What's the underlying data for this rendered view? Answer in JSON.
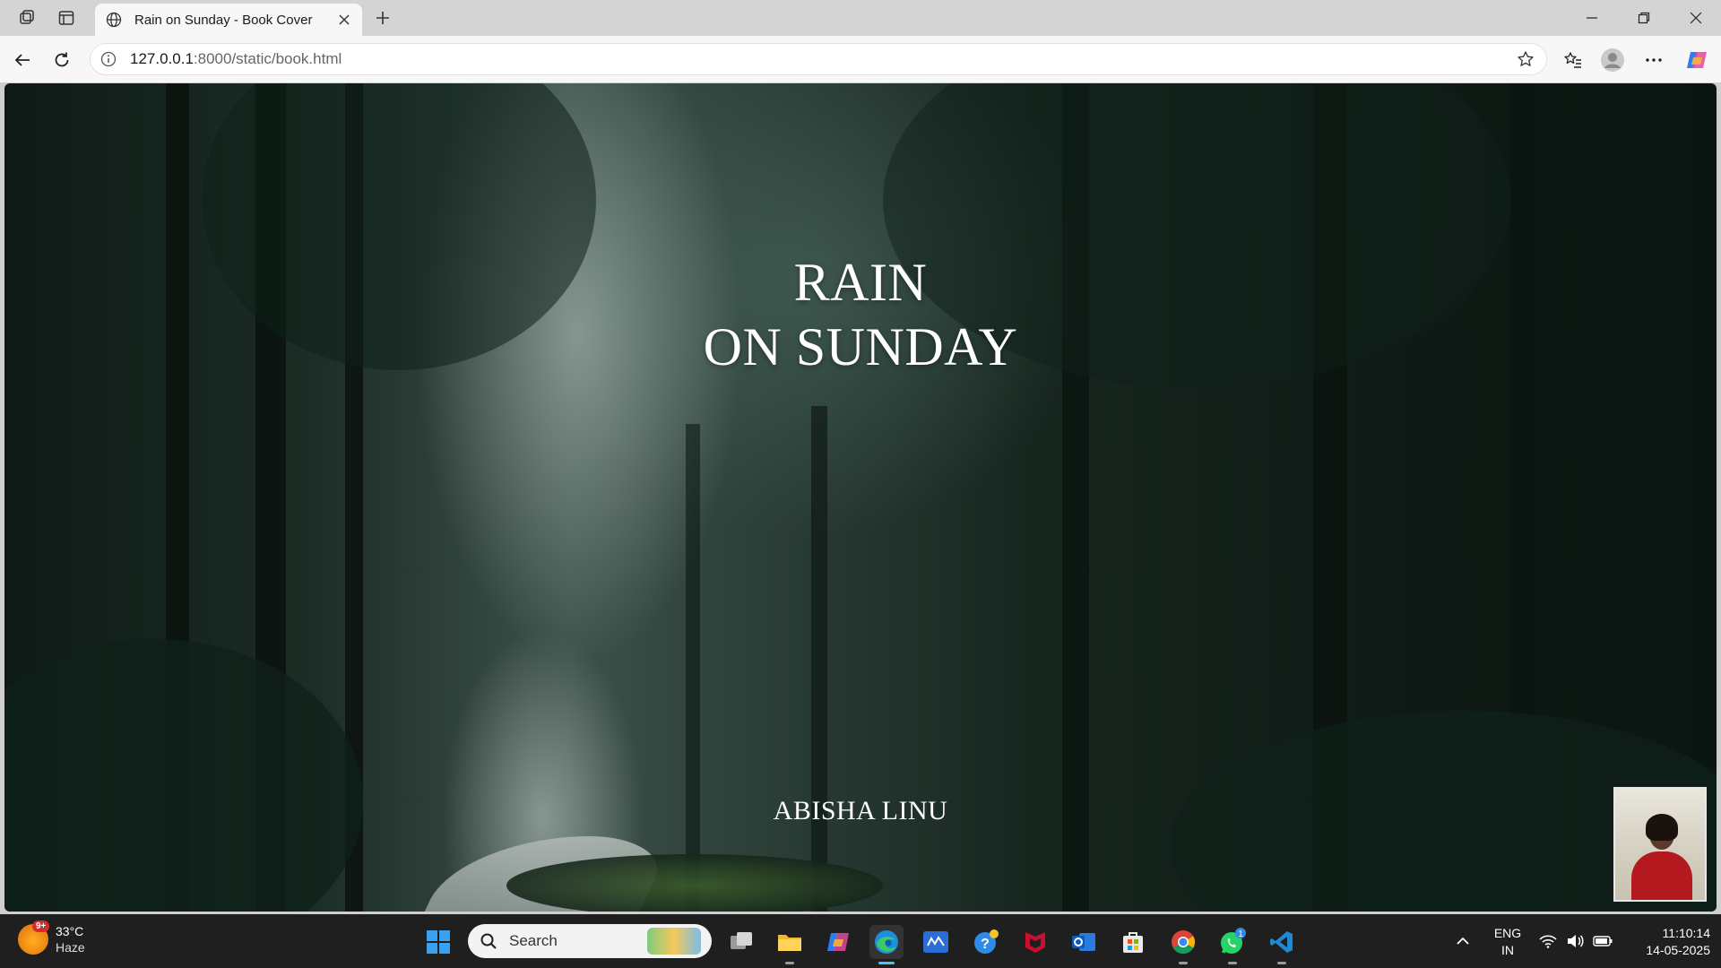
{
  "browser": {
    "tab_title": "Rain on Sunday - Book Cover",
    "url_host": "127.0.0.1",
    "url_rest": ":8000/static/book.html"
  },
  "page": {
    "title_line1": "RAIN",
    "title_line2": "ON SUNDAY",
    "author": "ABISHA LINU"
  },
  "taskbar": {
    "weather_badge": "9+",
    "temperature": "33°C",
    "condition": "Haze",
    "search_label": "Search",
    "lang_line1": "ENG",
    "lang_line2": "IN",
    "time": "11:10:14",
    "date": "14-05-2025",
    "whatsapp_badge": "1"
  },
  "colors": {
    "accent": "#4cc2ff",
    "forest_dark": "#0e1a15",
    "taskbar_bg": "#1f1f1f"
  }
}
